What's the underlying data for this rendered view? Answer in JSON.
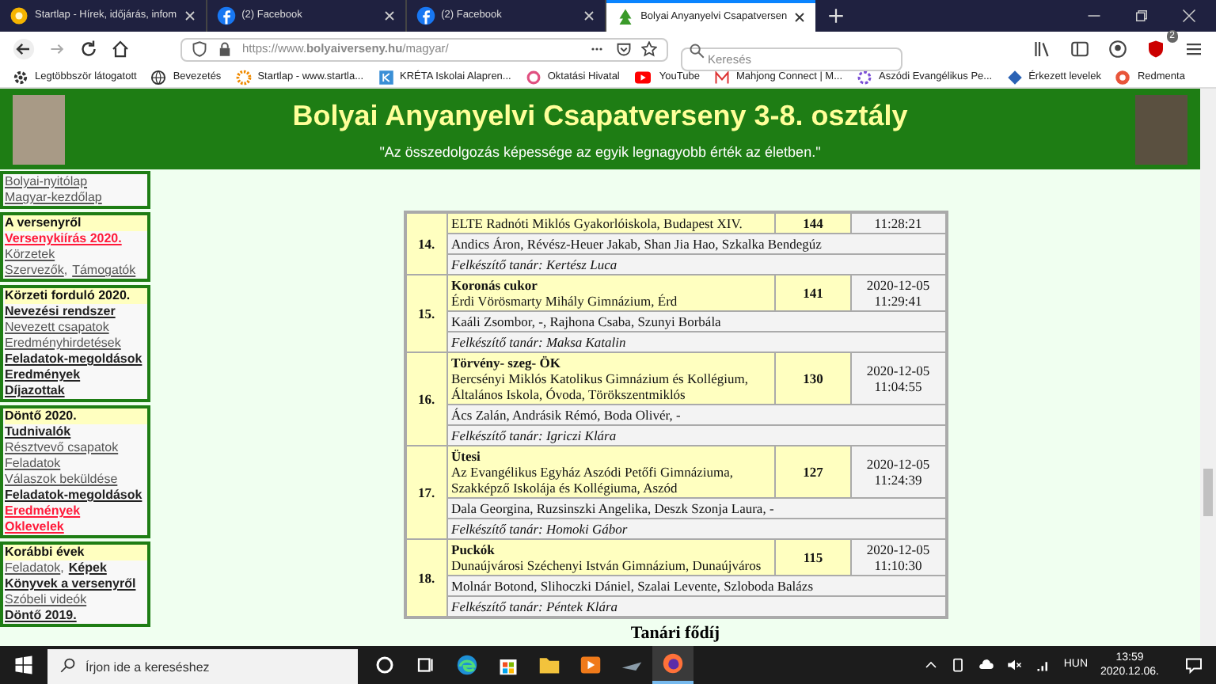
{
  "browser": {
    "tabs": [
      {
        "title": "Startlap - Hírek, időjárás, infom",
        "selected": false
      },
      {
        "title": "(2) Facebook",
        "selected": false
      },
      {
        "title": "(2) Facebook",
        "selected": false
      },
      {
        "title": "Bolyai Anyanyelvi Csapatversen",
        "selected": true
      }
    ],
    "address": "https://www.**bolyaiverseny.hu**/magyar/",
    "search": {
      "placeholder": "Keresés"
    },
    "extension_badge": "2",
    "bookmarks": [
      {
        "label": "Legtöbbször látogatott"
      },
      {
        "label": "Bevezetés"
      },
      {
        "label": "Startlap - www.startla..."
      },
      {
        "label": "KRÉTA Iskolai Alapren..."
      },
      {
        "label": "Oktatási Hivatal"
      },
      {
        "label": "YouTube"
      },
      {
        "label": "Mahjong Connect | M..."
      },
      {
        "label": "Aszódi Evangélikus Pe..."
      },
      {
        "label": "Érkezett levelek"
      },
      {
        "label": "Redmenta"
      }
    ]
  },
  "header": {
    "title": "Bolyai Anyanyelvi Csapatverseny 3-8. osztály",
    "motto": "\"Az összedolgozás képessége az egyik legnagyobb érték az életben.\""
  },
  "sidebar": [
    {
      "lines": [
        [
          {
            "text": "Bolyai-nyitólap",
            "kind": "link"
          }
        ],
        [
          {
            "text": "Magyar-kezdőlap",
            "kind": "link"
          }
        ]
      ]
    },
    {
      "heading": "A versenyről",
      "lines": [
        [
          {
            "text": "Versenykiírás 2020.",
            "kind": "highlight"
          }
        ],
        [
          {
            "text": "Körzetek",
            "kind": "link"
          }
        ],
        [
          {
            "text": "Szervezők",
            "kind": "link"
          },
          {
            "text": ",",
            "kind": "separator"
          },
          {
            "text": "Támogatók",
            "kind": "link"
          }
        ]
      ]
    },
    {
      "heading": "Körzeti forduló 2020.",
      "lines": [
        [
          {
            "text": "Nevezési rendszer",
            "kind": "main"
          }
        ],
        [
          {
            "text": "Nevezett csapatok",
            "kind": "link"
          }
        ],
        [
          {
            "text": "Eredményhirdetések",
            "kind": "link"
          }
        ],
        [
          {
            "text": "Feladatok-megoldások",
            "kind": "main"
          }
        ],
        [
          {
            "text": "Eredmények",
            "kind": "main"
          }
        ],
        [
          {
            "text": "Díjazottak",
            "kind": "main"
          }
        ]
      ]
    },
    {
      "heading": "Döntő 2020.",
      "lines": [
        [
          {
            "text": "Tudnivalók",
            "kind": "main"
          }
        ],
        [
          {
            "text": "Résztvevő csapatok",
            "kind": "link"
          }
        ],
        [
          {
            "text": "Feladatok",
            "kind": "link"
          }
        ],
        [
          {
            "text": "Válaszok beküldése",
            "kind": "link"
          }
        ],
        [
          {
            "text": "Feladatok-megoldások",
            "kind": "main"
          }
        ],
        [
          {
            "text": "Eredmények",
            "kind": "highlight"
          }
        ],
        [
          {
            "text": "Oklevelek",
            "kind": "highlight"
          }
        ]
      ]
    },
    {
      "heading": "Korábbi évek",
      "lines": [
        [
          {
            "text": "Feladatok",
            "kind": "link"
          },
          {
            "text": ",",
            "kind": "separator"
          },
          {
            "text": "Képek",
            "kind": "main"
          }
        ],
        [
          {
            "text": "Könyvek a versenyről",
            "kind": "main"
          }
        ],
        [
          {
            "text": "Szóbeli videók",
            "kind": "link"
          }
        ],
        [
          {
            "text": "Döntő 2019.",
            "kind": "main"
          }
        ]
      ]
    }
  ],
  "results": [
    {
      "rank": "14.",
      "school": "ELTE Radnóti Miklós Gyakorlóiskola, Budapest XIV.",
      "score": "144",
      "time": "11:28:21",
      "members": "Andics Áron, Révész-Heuer Jakab, Shan Jia Hao, Szkalka Bendegúz",
      "teacher": "Felkészítő tanár: Kertész Luca"
    },
    {
      "rank": "15.",
      "team": "Koronás cukor",
      "school": "Érdi Vörösmarty Mihály Gimnázium, Érd",
      "score": "141",
      "date": "2020-12-05",
      "time": "11:29:41",
      "members": "Kaáli Zsombor, -, Rajhona Csaba, Szunyi Borbála",
      "teacher": "Felkészítő tanár: Maksa Katalin"
    },
    {
      "rank": "16.",
      "team": "Törvény- szeg- ÖK",
      "school": "Bercsényi Miklós Katolikus Gimnázium és Kollégium, Általános Iskola, Óvoda, Törökszentmiklós",
      "score": "130",
      "date": "2020-12-05",
      "time": "11:04:55",
      "members": "Ács Zalán, Andrásik Rémó, Boda Olivér, -",
      "teacher": "Felkészítő tanár: Igriczi Klára"
    },
    {
      "rank": "17.",
      "team": "Ütesi",
      "school": "Az Evangélikus Egyház Aszódi Petőfi Gimnáziuma, Szakképző Iskolája és Kollégiuma, Aszód",
      "score": "127",
      "date": "2020-12-05",
      "time": "11:24:39",
      "members": "Dala Georgina, Ruzsinszki Angelika, Deszk Szonja Laura, -",
      "teacher": "Felkészítő tanár: Homoki Gábor"
    },
    {
      "rank": "18.",
      "team": "Puckók",
      "school": "Dunaújvárosi Széchenyi István Gimnázium, Dunaújváros",
      "score": "115",
      "date": "2020-12-05",
      "time": "11:10:30",
      "members": "Molnár Botond, Slihoczki Dániel, Szalai Levente, Szloboda Balázs",
      "teacher": "Felkészítő tanár: Péntek Klára"
    }
  ],
  "next_heading": "Tanári fődíj",
  "taskbar": {
    "search": {
      "placeholder": "Írjon ide a kereséshez"
    },
    "apps": [
      {
        "kind": "cortana",
        "selected": false
      },
      {
        "kind": "taskview",
        "selected": false
      },
      {
        "kind": "edge",
        "selected": false
      },
      {
        "kind": "store",
        "selected": false
      },
      {
        "kind": "explorer",
        "selected": false
      },
      {
        "kind": "media",
        "selected": false
      },
      {
        "kind": "app",
        "selected": false
      },
      {
        "kind": "firefox",
        "selected": true
      }
    ],
    "language": "HUN",
    "time": "13:59",
    "date": "2020.12.06."
  }
}
